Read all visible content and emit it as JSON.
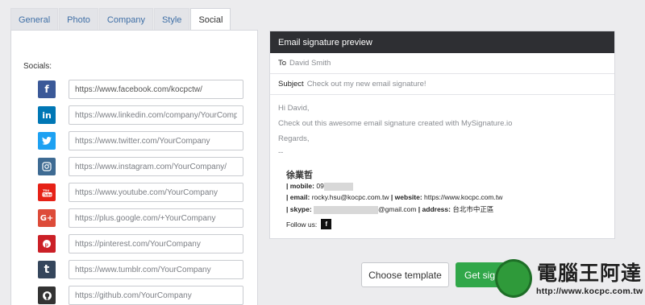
{
  "tabs": [
    {
      "label": "General",
      "active": false
    },
    {
      "label": "Photo",
      "active": false
    },
    {
      "label": "Company",
      "active": false
    },
    {
      "label": "Style",
      "active": false
    },
    {
      "label": "Social",
      "active": true
    }
  ],
  "socials": {
    "label": "Socials:",
    "items": [
      {
        "network": "facebook",
        "icon": "facebook-icon",
        "glyph": "f",
        "color": "#3b5998",
        "value": "https://www.facebook.com/kocpctw/",
        "placeholder": ""
      },
      {
        "network": "linkedin",
        "icon": "linkedin-icon",
        "glyph": "in",
        "color": "#0077b5",
        "value": "",
        "placeholder": "https://www.linkedin.com/company/YourCompany"
      },
      {
        "network": "twitter",
        "icon": "twitter-icon",
        "glyph": "🐦",
        "color": "#1da1f2",
        "value": "",
        "placeholder": "https://www.twitter.com/YourCompany"
      },
      {
        "network": "instagram",
        "icon": "instagram-icon",
        "glyph": "◎",
        "color": "#3e6b93",
        "value": "",
        "placeholder": "https://www.instagram.com/YourCompany/"
      },
      {
        "network": "youtube",
        "icon": "youtube-icon",
        "glyph": "▶",
        "color": "#e62117",
        "value": "",
        "placeholder": "https://www.youtube.com/YourCompany"
      },
      {
        "network": "googleplus",
        "icon": "google-plus-icon",
        "glyph": "G+",
        "color": "#dd4b39",
        "value": "",
        "placeholder": "https://plus.google.com/+YourCompany"
      },
      {
        "network": "pinterest",
        "icon": "pinterest-icon",
        "glyph": "℗",
        "color": "#cb2027",
        "value": "",
        "placeholder": "https://pinterest.com/YourCompany"
      },
      {
        "network": "tumblr",
        "icon": "tumblr-icon",
        "glyph": "t",
        "color": "#35465c",
        "value": "",
        "placeholder": "https://www.tumblr.com/YourCompany"
      },
      {
        "network": "github",
        "icon": "github-icon",
        "glyph": "◉",
        "color": "#333333",
        "value": "",
        "placeholder": "https://github.com/YourCompany"
      }
    ]
  },
  "preview": {
    "header": "Email signature preview",
    "to_label": "To",
    "to_value": "David Smith",
    "subject_label": "Subject",
    "subject_value": "Check out my new email signature!",
    "greeting": "Hi David,",
    "body": "Check out this awesome email signature created with MySignature.io",
    "closing": "Regards,",
    "separator": "--",
    "signature": {
      "name": "徐業哲",
      "mobile_label": "| mobile:",
      "mobile_value": "09",
      "email_label": "| email:",
      "email_value": "rocky.hsu@kocpc.com.tw",
      "website_label": "| website:",
      "website_value": "https://www.kocpc.com.tw",
      "skype_label": "| skype:",
      "skype_value": "@gmail.com",
      "address_label": "| address:",
      "address_value": "台北市中正區",
      "follow_label": "Follow us:",
      "follow_glyph": "f"
    }
  },
  "buttons": {
    "choose_template": "Choose template",
    "get_signature": "Get signature"
  },
  "watermark": {
    "title": "電腦王阿達",
    "url": "http://www.kocpc.com.tw"
  }
}
